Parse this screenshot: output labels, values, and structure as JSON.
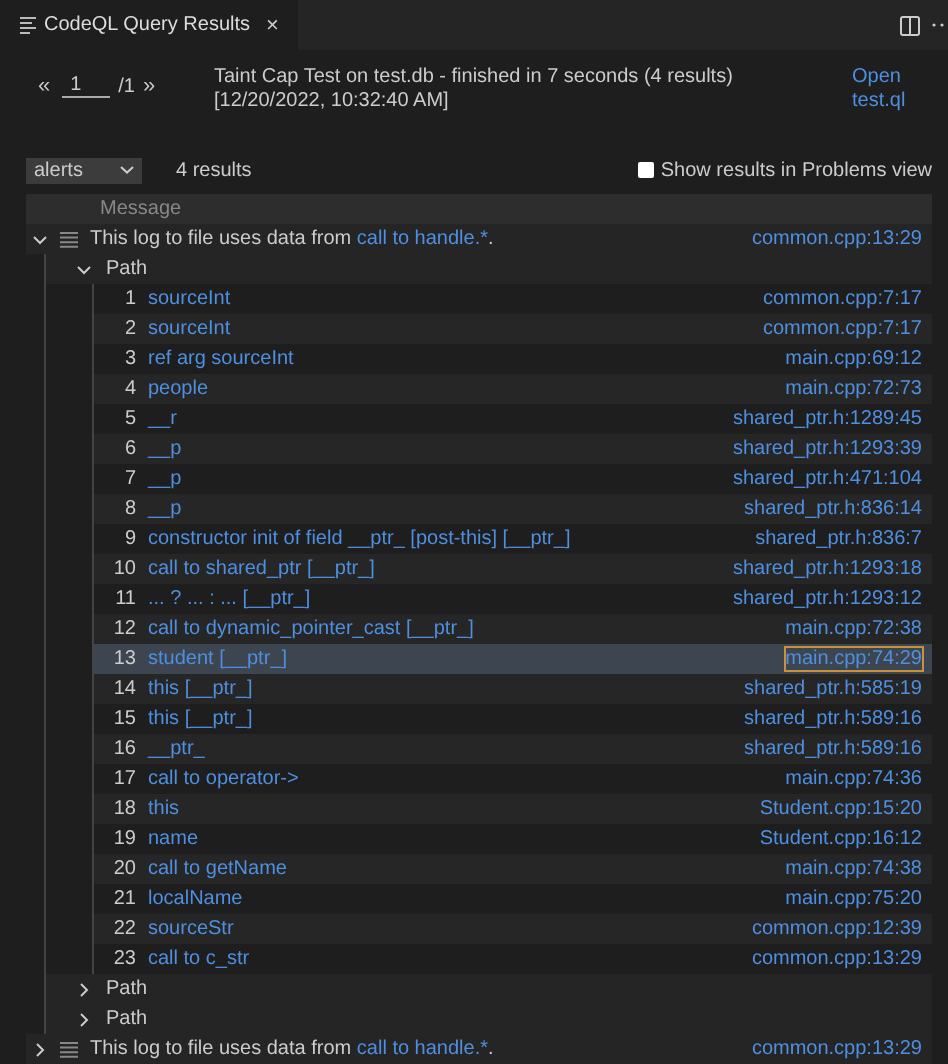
{
  "tab": {
    "title": "CodeQL Query Results",
    "close": "×"
  },
  "pager": {
    "first": "«",
    "value": "1",
    "total": "/1",
    "last": "»"
  },
  "query": {
    "title": "Taint Cap Test on test.db - finished in 7 seconds (4 results)",
    "time": "[12/20/2022, 10:32:40 AM]",
    "open_link": "Open test.ql"
  },
  "toolbar": {
    "select": "alerts",
    "count": "4 results",
    "problems_checkbox": {
      "label": "Show results in Problems view",
      "checked": false
    }
  },
  "table": {
    "column": "Message",
    "results": [
      {
        "expanded": true,
        "prefix": "This log to file uses data from ",
        "link": "call to handle.*",
        "suffix": ".",
        "location": "common.cpp:13:29",
        "paths": [
          {
            "label": "Path",
            "expanded": true,
            "steps": [
              {
                "index": "1",
                "label": "sourceInt",
                "location": "common.cpp:7:17",
                "selected": false
              },
              {
                "index": "2",
                "label": "sourceInt",
                "location": "common.cpp:7:17",
                "selected": false
              },
              {
                "index": "3",
                "label": "ref arg sourceInt",
                "location": "main.cpp:69:12",
                "selected": false
              },
              {
                "index": "4",
                "label": "people",
                "location": "main.cpp:72:73",
                "selected": false
              },
              {
                "index": "5",
                "label": "__r",
                "location": "shared_ptr.h:1289:45",
                "selected": false
              },
              {
                "index": "6",
                "label": "__p",
                "location": "shared_ptr.h:1293:39",
                "selected": false
              },
              {
                "index": "7",
                "label": "__p",
                "location": "shared_ptr.h:471:104",
                "selected": false
              },
              {
                "index": "8",
                "label": "__p",
                "location": "shared_ptr.h:836:14",
                "selected": false
              },
              {
                "index": "9",
                "label": "constructor init of field __ptr_ [post-this] [__ptr_]",
                "location": "shared_ptr.h:836:7",
                "selected": false
              },
              {
                "index": "10",
                "label": "call to shared_ptr [__ptr_]",
                "location": "shared_ptr.h:1293:18",
                "selected": false
              },
              {
                "index": "11",
                "label": "... ? ... : ... [__ptr_]",
                "location": "shared_ptr.h:1293:12",
                "selected": false
              },
              {
                "index": "12",
                "label": "call to dynamic_pointer_cast [__ptr_]",
                "location": "main.cpp:72:38",
                "selected": false
              },
              {
                "index": "13",
                "label": "student [__ptr_]",
                "location": "main.cpp:74:29",
                "selected": true
              },
              {
                "index": "14",
                "label": "this [__ptr_]",
                "location": "shared_ptr.h:585:19",
                "selected": false
              },
              {
                "index": "15",
                "label": "this [__ptr_]",
                "location": "shared_ptr.h:589:16",
                "selected": false
              },
              {
                "index": "16",
                "label": "__ptr_",
                "location": "shared_ptr.h:589:16",
                "selected": false
              },
              {
                "index": "17",
                "label": "call to operator->",
                "location": "main.cpp:74:36",
                "selected": false
              },
              {
                "index": "18",
                "label": "this",
                "location": "Student.cpp:15:20",
                "selected": false
              },
              {
                "index": "19",
                "label": "name",
                "location": "Student.cpp:16:12",
                "selected": false
              },
              {
                "index": "20",
                "label": "call to getName",
                "location": "main.cpp:74:38",
                "selected": false
              },
              {
                "index": "21",
                "label": "localName",
                "location": "main.cpp:75:20",
                "selected": false
              },
              {
                "index": "22",
                "label": "sourceStr",
                "location": "common.cpp:12:39",
                "selected": false
              },
              {
                "index": "23",
                "label": "call to c_str",
                "location": "common.cpp:13:29",
                "selected": false
              }
            ]
          },
          {
            "label": "Path",
            "expanded": false
          },
          {
            "label": "Path",
            "expanded": false
          }
        ]
      },
      {
        "expanded": false,
        "prefix": "This log to file uses data from ",
        "link": "call to handle.*",
        "suffix": ".",
        "location": "common.cpp:13:29"
      }
    ]
  }
}
